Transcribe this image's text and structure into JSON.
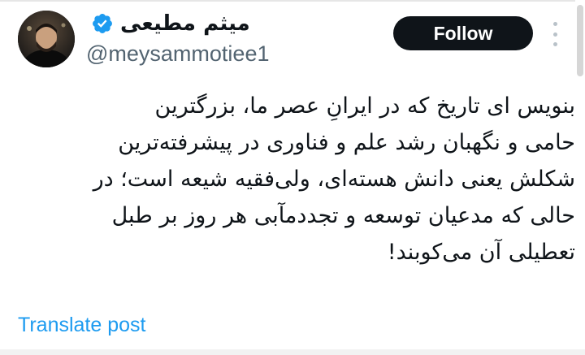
{
  "author": {
    "display_name": "میثم مطیعی",
    "handle": "@meysammotiee1",
    "verified": true,
    "avatar_icon": "profile-photo",
    "verified_icon": "verified-badge-icon"
  },
  "header": {
    "follow_label": "Follow",
    "more_icon": "more-options-icon"
  },
  "post": {
    "lines": [
      "بنویس ای تاریخ که در ایرانِ عصر ما، بزرگترین",
      "حامی و نگهبان رشد علم و فناوری در پیشرفته‌ترین",
      "شکلش یعنی دانش هسته‌ای، ولی‌فقیه شیعه است؛ در",
      "حالی که مدعیان توسعه و تجددمآبی هر روز بر طبل",
      "تعطیلی آن می‌کوبند!"
    ]
  },
  "footer": {
    "translate_label": "Translate post"
  },
  "colors": {
    "accent": "#1d9bf0",
    "text": "#0f1419",
    "secondary_text": "#536471",
    "button_bg": "#0f1419"
  }
}
